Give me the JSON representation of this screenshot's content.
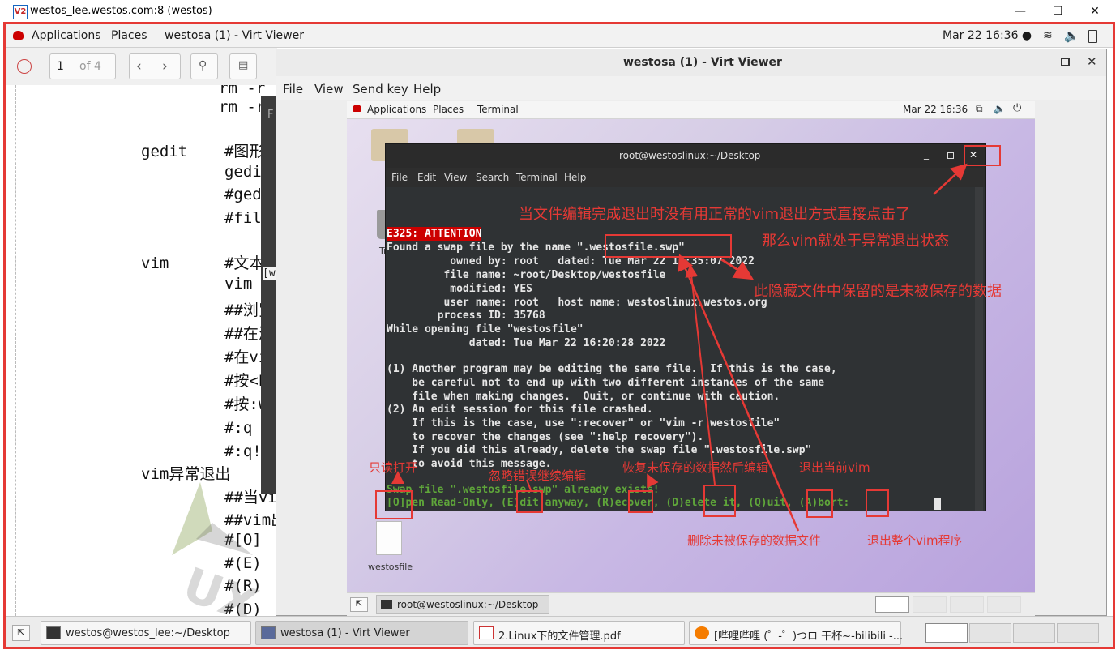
{
  "outer_window": {
    "title": "westos_lee.westos.com:8 (westos)",
    "minimize": "—",
    "maximize": "☐",
    "close": "✕"
  },
  "gnome_bar": {
    "applications": "Applications",
    "places": "Places",
    "active_app": "westosa (1) - Virt Viewer",
    "clock": "Mar 22  16:36 ●"
  },
  "pdf_viewer": {
    "page_value": "1",
    "page_total": "of 4",
    "lines": [
      "rm -r",
      "rm -r",
      "gedit    #图形的",
      "         gedit",
      "         #gedit",
      "         #file",
      "vim      #文本编",
      "         vim fi",
      "         ##浏览模",
      "         ##在浏览",
      "         #在vim中",
      "         #按<ESC",
      "         #按:wq",
      "         #:q 当v",
      "         #:q! 当",
      "vim异常退出",
      "         ##当vim",
      "         ##vim出",
      "         #[O]",
      "         #(E)",
      "         #(R)",
      "         #(D)"
    ],
    "dark_win_label": "F",
    "dark_win_label2": "[w"
  },
  "virt_viewer": {
    "title": "westosa (1) - Virt Viewer",
    "menu": [
      "File",
      "View",
      "Send key",
      "Help"
    ]
  },
  "guest": {
    "applications": "Applications",
    "places": "Places",
    "terminal": "Terminal",
    "clock": "Mar 22  16:36",
    "trash_label": "Trash",
    "file_label": "westosfile",
    "task_label": "root@westoslinux:~/Desktop"
  },
  "terminal": {
    "title": "root@westoslinux:~/Desktop",
    "menu": [
      "File",
      "Edit",
      "View",
      "Search",
      "Terminal",
      "Help"
    ],
    "attention": "E325: ATTENTION",
    "lines": [
      "Found a swap file by the name \".westosfile.swp\"",
      "          owned by: root   dated: Tue Mar 22 16:35:07 2022",
      "         file name: ~root/Desktop/westosfile",
      "          modified: YES",
      "         user name: root   host name: westoslinux.westos.org",
      "        process ID: 35768",
      "While opening file \"westosfile\"",
      "             dated: Tue Mar 22 16:20:28 2022",
      "",
      "(1) Another program may be editing the same file.  If this is the case,",
      "    be careful not to end up with two different instances of the same",
      "    file when making changes.  Quit, or continue with caution.",
      "(2) An edit session for this file crashed.",
      "    If this is the case, use \":recover\" or \"vim -r westosfile\"",
      "    to recover the changes (see \":help recovery\").",
      "    If you did this already, delete the swap file \".westosfile.swp\"",
      "    to avoid this message."
    ],
    "exists_line": "Swap file \".westosfile.swp\" already exists!",
    "options_line": "[O]pen Read-Only, (E)dit anyway, (R)ecover, (D)elete it, (Q)uit, (A)bort:"
  },
  "annotations": {
    "close_note_1": "当文件编辑完成退出时没有用正常的vim退出方式直接点击了",
    "close_note_2": "那么vim就处于异常退出状态",
    "swp_note": "此隐藏文件中保留的是未被保存的数据",
    "open_ro": "只读打开",
    "edit_anyway": "忽略错误继续编辑",
    "recover": "恢复未保存的数据然后编辑",
    "quit": "退出当前vim",
    "delete": "删除未被保存的数据文件",
    "abort": "退出整个vim程序"
  },
  "taskbar": {
    "items": [
      "westos@westos_lee:~/Desktop",
      "westosa (1) - Virt Viewer",
      "2.Linux下的文件管理.pdf",
      "[哔哩哔哩 (゜-゜)つロ 干杯~-bilibili -..."
    ]
  },
  "colors": {
    "annotation_red": "#e53935",
    "terminal_bg": "#2f3234",
    "attention_bg": "#cc0000",
    "prompt_green": "#5fa63a"
  }
}
